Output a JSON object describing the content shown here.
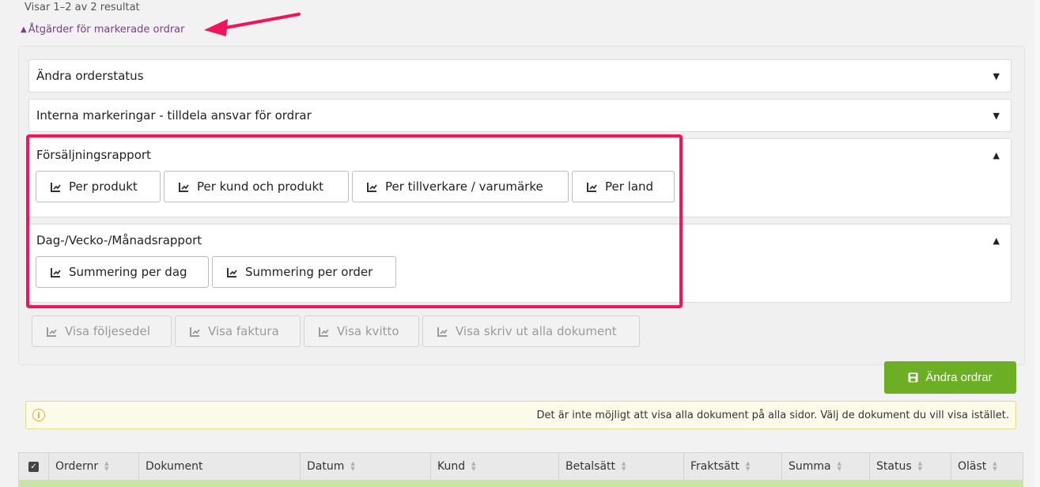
{
  "results": {
    "text": "Visar 1–2 av 2 resultat"
  },
  "actions_toggle": {
    "label": "Åtgärder för markerade ordrar"
  },
  "accordions": [
    {
      "title": "Ändra orderstatus"
    },
    {
      "title": "Interna markeringar - tilldela ansvar för ordrar"
    },
    {
      "title": "Försäljningsrapport",
      "buttons": [
        "Per produkt",
        "Per kund och produkt",
        "Per tillverkare / varumärke",
        "Per land"
      ]
    },
    {
      "title": "Dag-/Vecko-/Månadsrapport",
      "buttons": [
        "Summering per dag",
        "Summering per order"
      ]
    }
  ],
  "document_buttons": [
    "Visa följesedel",
    "Visa faktura",
    "Visa kvitto",
    "Visa skriv ut alla dokument"
  ],
  "primary_button": {
    "label": "Ändra ordrar"
  },
  "warning": {
    "icon": "info-icon",
    "text": "Det är inte möjligt att visa alla dokument på alla sidor. Välj de dokument du vill visa istället."
  },
  "table": {
    "columns": [
      "Ordernr",
      "Dokument",
      "Datum",
      "Kund",
      "Betalsätt",
      "Fraktsätt",
      "Summa",
      "Status",
      "Oläst"
    ]
  },
  "colors": {
    "highlight": "#f0145a",
    "primary": "#6cae24",
    "link": "#7a3d8c"
  }
}
